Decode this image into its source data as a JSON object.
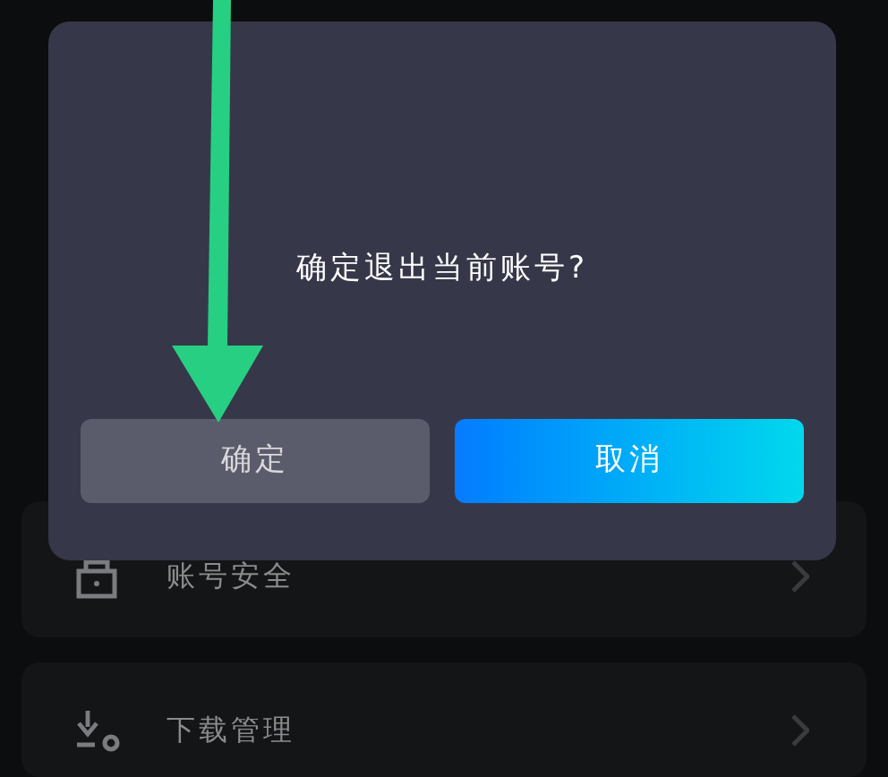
{
  "settings_items": [
    {
      "label": "账号安全",
      "kind": "security"
    },
    {
      "label": "下载管理",
      "kind": "download"
    }
  ],
  "dialog": {
    "message": "确定退出当前账号?",
    "buttons": [
      {
        "label": "确定",
        "kind": "secondary"
      },
      {
        "label": "取消",
        "kind": "primary"
      }
    ]
  }
}
